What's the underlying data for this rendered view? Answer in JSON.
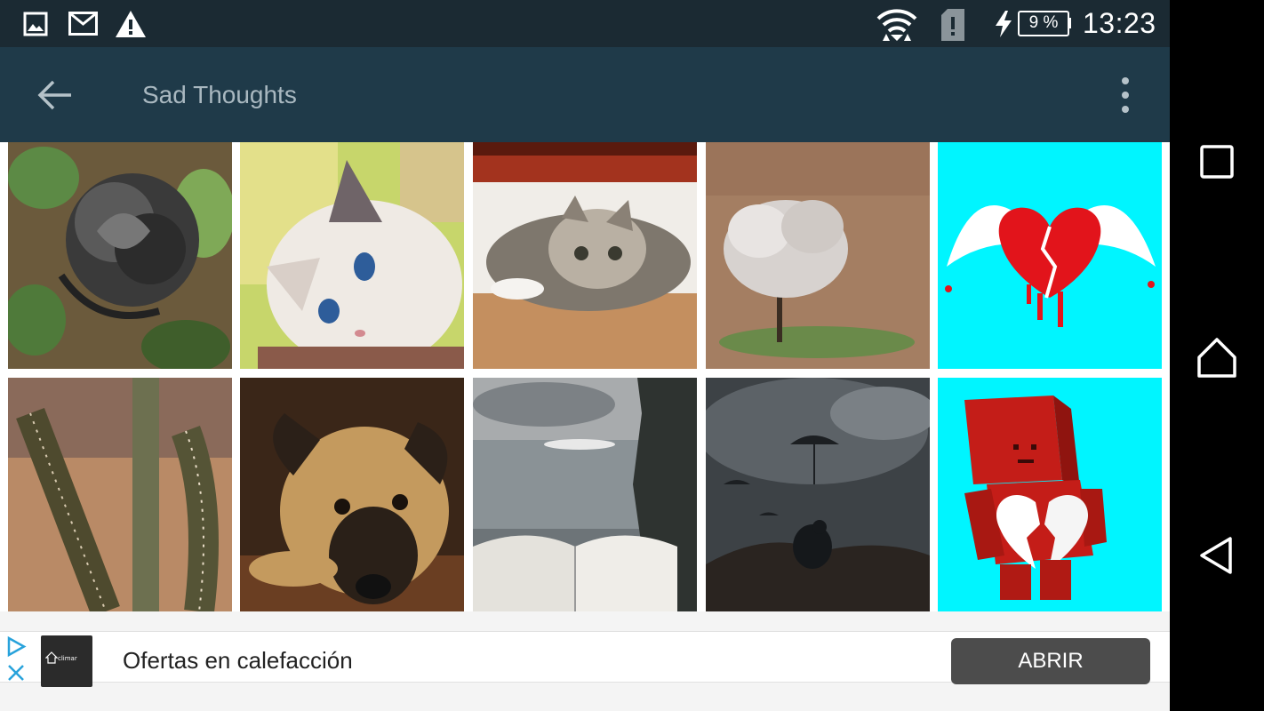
{
  "status_bar": {
    "time": "13:23",
    "battery_percent": "9 %",
    "icons": [
      "image-icon",
      "gmail-icon",
      "warning-icon",
      "wifi-icon",
      "sim-alert-icon",
      "charging-icon"
    ]
  },
  "toolbar": {
    "title": "Sad Thoughts",
    "back_icon": "arrow-back-icon",
    "menu_icon": "more-vertical-icon"
  },
  "grid": {
    "tiles": [
      {
        "subject": "black rose"
      },
      {
        "subject": "white kitten"
      },
      {
        "subject": "tabby kitten"
      },
      {
        "subject": "lone tree"
      },
      {
        "subject": "winged broken heart"
      },
      {
        "subject": "cactus"
      },
      {
        "subject": "sad puppy"
      },
      {
        "subject": "book by the sea"
      },
      {
        "subject": "person under umbrellas"
      },
      {
        "subject": "red box robot"
      }
    ]
  },
  "ad": {
    "logo_text": "climar",
    "text": "Ofertas en calefacción",
    "button_label": "ABRIR"
  },
  "nav_bar": {
    "buttons": [
      "recents-icon",
      "home-icon",
      "back-triangle-icon"
    ]
  },
  "colors": {
    "status_bar": "#1b2a33",
    "toolbar": "#1f3a49",
    "title_text": "#a9b8c0",
    "ad_button": "#4c4c4c",
    "cyan_tile": "#00f5ff"
  }
}
